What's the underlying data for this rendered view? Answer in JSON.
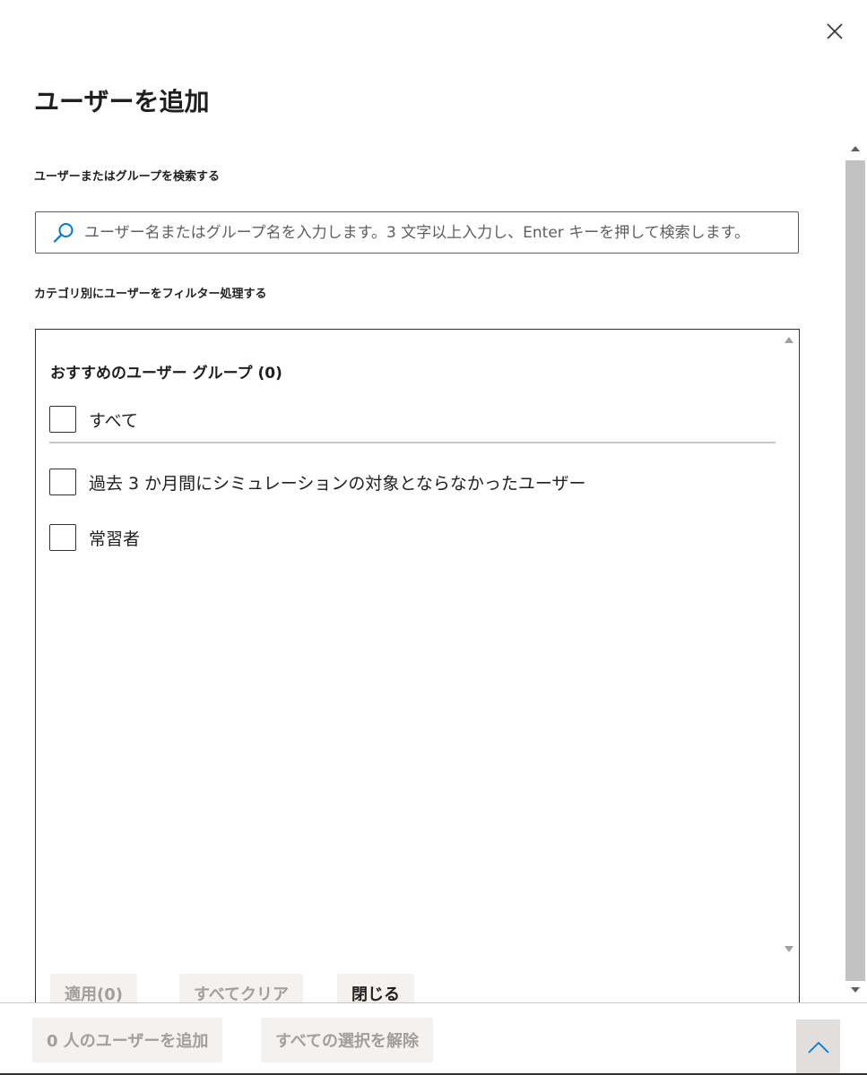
{
  "panel": {
    "title": "ユーザーを追加",
    "close_icon": "close-icon"
  },
  "search": {
    "label": "ユーザーまたはグループを検索する",
    "placeholder": "ユーザー名またはグループ名を入力します。3 文字以上入力し、Enter キーを押して検索します。",
    "value": "",
    "icon": "search-icon"
  },
  "filter": {
    "label": "カテゴリ別にユーザーをフィルター処理する",
    "group_heading": "おすすめのユーザー グループ (0)",
    "select_all": {
      "label": "すべて",
      "checked": false
    },
    "items": [
      {
        "label": "過去 3 か月間にシミュレーションの対象とならなかったユーザー",
        "checked": false
      },
      {
        "label": "常習者",
        "checked": false
      }
    ],
    "buttons": {
      "apply": "適用(0)",
      "clear_all": "すべてクリア",
      "close": "閉じる"
    }
  },
  "footer": {
    "add_users": "0 人のユーザーを追加",
    "deselect_all": "すべての選択を解除",
    "expand_icon": "chevron-up-icon"
  },
  "colors": {
    "accent": "#0078d4",
    "text": "#201f1e",
    "disabled_text": "#a19f9d",
    "button_bg": "#f3f2f1",
    "border": "#323130"
  }
}
